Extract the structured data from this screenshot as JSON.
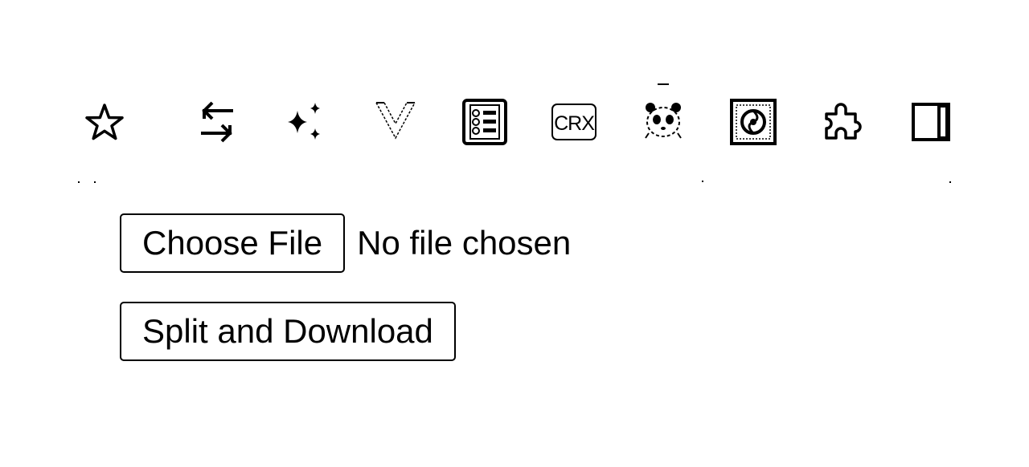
{
  "toolbar": {
    "icons": [
      "bookmark-star-icon",
      "sync-arrows-icon",
      "sparkles-icon",
      "vue-devtools-icon",
      "form-list-extension-icon",
      "crx-extension-icon",
      "panda-extension-icon",
      "circular-logo-extension-icon",
      "extensions-puzzle-icon",
      "side-panel-icon"
    ],
    "crx_label": "CRX"
  },
  "file_input": {
    "button_label": "Choose File",
    "status": "No file chosen"
  },
  "actions": {
    "split_download_label": "Split and Download"
  }
}
